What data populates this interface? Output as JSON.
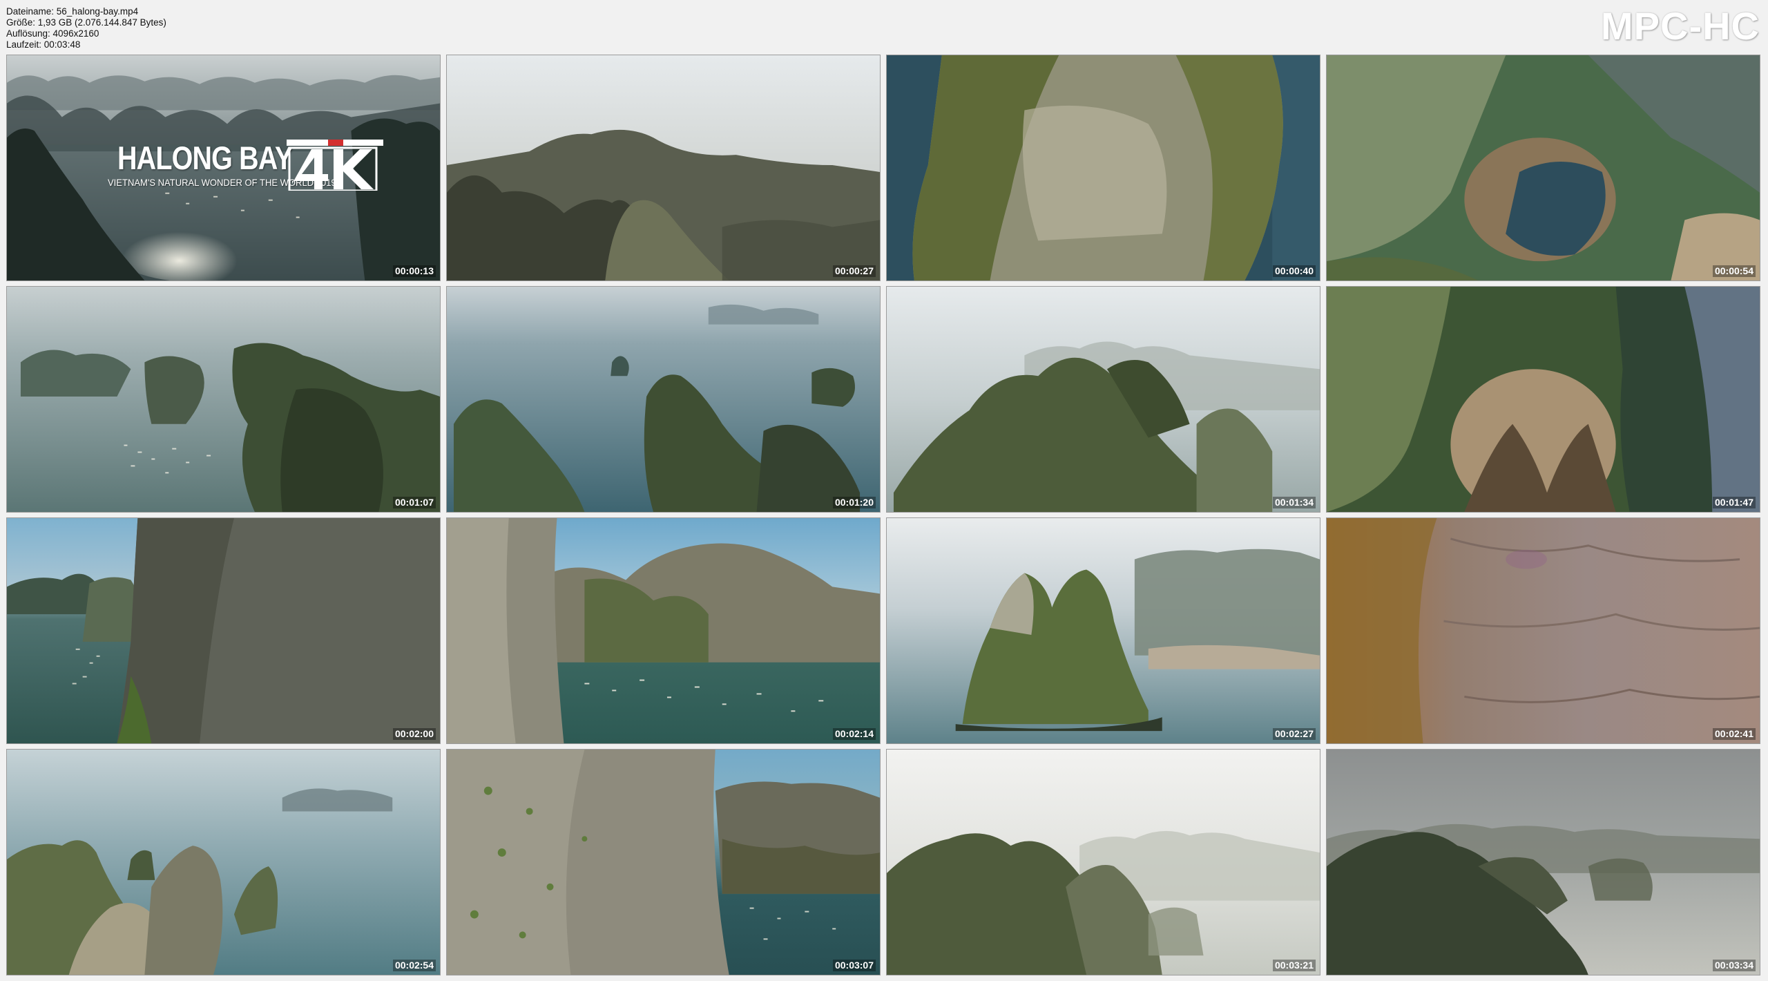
{
  "header": {
    "file_label": "Dateiname: 56_halong-bay.mp4",
    "size_label": "Größe: 1,93 GB (2.076.144.847 Bytes)",
    "resolution_label": "Auflösung: 4096x2160",
    "duration_label": "Laufzeit: 00:03:48",
    "logo": "MPC-HC"
  },
  "title_card": {
    "title": "HALONG BAY",
    "subtitle": "VIETNAM'S NATURAL WONDER OF THE WORLD 2019",
    "badge": "4K"
  },
  "thumbnails": [
    {
      "timestamp": "00:00:13",
      "scene": "bay-title"
    },
    {
      "timestamp": "00:00:27",
      "scene": "hazy-mountains"
    },
    {
      "timestamp": "00:00:40",
      "scene": "cliff-closeup"
    },
    {
      "timestamp": "00:00:54",
      "scene": "lagoon-topdown"
    },
    {
      "timestamp": "00:01:07",
      "scene": "bay-boats"
    },
    {
      "timestamp": "00:01:20",
      "scene": "islets-blue"
    },
    {
      "timestamp": "00:01:34",
      "scene": "misty-peaks"
    },
    {
      "timestamp": "00:01:47",
      "scene": "lagoon-topdown-2"
    },
    {
      "timestamp": "00:02:00",
      "scene": "cliff-left-water"
    },
    {
      "timestamp": "00:02:14",
      "scene": "cliffs-boats"
    },
    {
      "timestamp": "00:02:27",
      "scene": "island-beach"
    },
    {
      "timestamp": "00:02:41",
      "scene": "rock-face"
    },
    {
      "timestamp": "00:02:54",
      "scene": "islands-haze"
    },
    {
      "timestamp": "00:03:07",
      "scene": "cliff-wall-boats"
    },
    {
      "timestamp": "00:03:21",
      "scene": "foggy-peaks"
    },
    {
      "timestamp": "00:03:34",
      "scene": "dark-peaks"
    }
  ]
}
